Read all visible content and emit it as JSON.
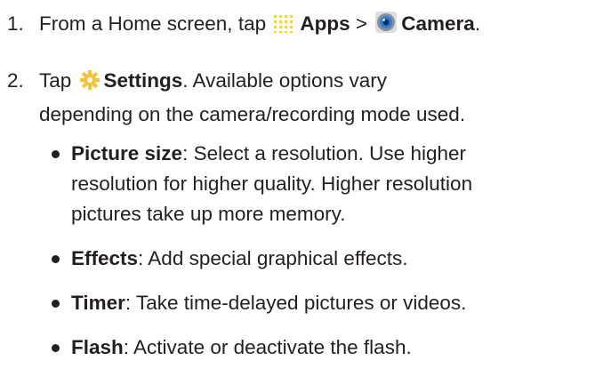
{
  "steps": [
    {
      "number": "1.",
      "prefix": "From a Home screen, tap ",
      "apps_icon": "apps-grid-icon",
      "apps_label": "Apps",
      "separator": " > ",
      "camera_icon": "camera-icon",
      "camera_label": "Camera",
      "suffix": "."
    },
    {
      "number": "2.",
      "prefix": "Tap ",
      "settings_icon": "gear-icon",
      "settings_label": "Settings",
      "text_line1": ". Available options vary",
      "text_line2": "depending on the camera/recording mode used."
    }
  ],
  "bullets": [
    {
      "term": "Picture size",
      "lines": [
        ": Select a resolution. Use higher",
        "resolution for higher quality. Higher resolution",
        "pictures take up more memory."
      ]
    },
    {
      "term": "Effects",
      "lines": [
        ": Add special graphical effects."
      ]
    },
    {
      "term": "Timer",
      "lines": [
        ": Take time-delayed pictures or videos."
      ]
    },
    {
      "term": "Flash",
      "lines": [
        ": Activate or deactivate the flash."
      ]
    }
  ],
  "colors": {
    "text": "#231f20",
    "icon_grid": "#f5d23a",
    "gear": "#f2c43a",
    "camera_ring": "#8a8f95",
    "camera_lens": "#2f7fd4"
  }
}
